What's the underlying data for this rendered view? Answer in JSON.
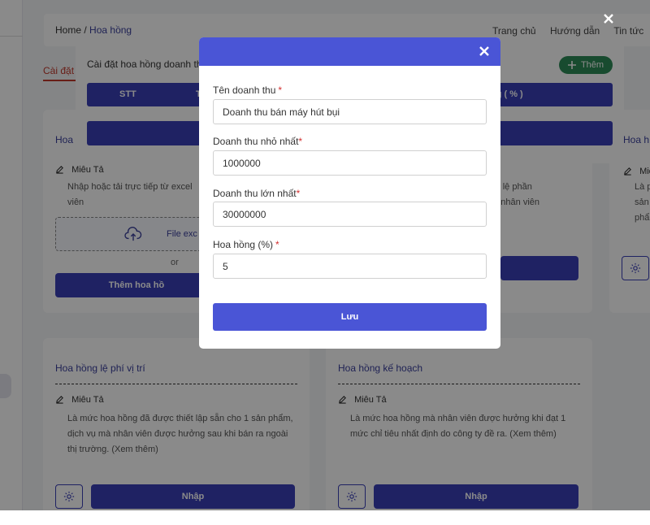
{
  "breadcrumb": {
    "home": "Home",
    "sep": "/",
    "current": "Hoa hồng"
  },
  "top_links": [
    "Trang chủ",
    "Hướng dẫn",
    "Tin tức"
  ],
  "tab_label": "Cài đặt",
  "settings_modal": {
    "title": "Cài đặt hoa hồng doanh th",
    "add_label": "Thêm",
    "columns": [
      "STT",
      "T",
      "ng ( % )"
    ]
  },
  "cards": [
    {
      "title": "Hoa",
      "desc_label": "Miêu Tả",
      "desc": "Nhập hoặc tải trực tiếp từ excel",
      "desc2": "viên",
      "file_label": "File exc",
      "or_label": "or",
      "button_label": "Thêm hoa hồ"
    },
    {
      "desc_frag1": "t tỷ lệ phần",
      "desc_frag2": "do nhân viên"
    },
    {
      "title": "Hoa h",
      "desc_label": "Miê",
      "desc1": "Là p",
      "desc2": "sản",
      "desc3": "phẩ"
    },
    {
      "title": "Hoa hồng lệ phí vị trí",
      "desc_label": "Miêu Tả",
      "desc": "Là mức hoa hồng đã được thiết lập sẵn cho 1 sản phẩm, dịch vụ mà nhân viên được hưởng sau khi bán ra ngoài thị trường. (Xem thêm)",
      "button_label": "Nhập"
    },
    {
      "title": "Hoa hồng kế hoạch",
      "desc_label": "Miêu Tả",
      "desc": "Là mức hoa hồng mà nhân viên được hưởng khi đạt 1 mức chỉ tiêu nhất định do công ty đề ra. (Xem thêm)",
      "button_label": "Nhập"
    }
  ],
  "form": {
    "name_label": "Tên doanh thu",
    "name_value": "Doanh thu bán máy hút bụi",
    "min_label": "Doanh thu nhỏ nhất",
    "min_value": "1000000",
    "max_label": "Doanh thu lớn nhất",
    "max_value": "30000000",
    "rate_label": "Hoa hồng (%)",
    "rate_value": "5",
    "required_mark": "*",
    "save_label": "Lưu"
  },
  "colors": {
    "primary": "#4a55d6",
    "dark_primary": "#3a3fb8",
    "success": "#2e8b57",
    "required": "#d32f2f"
  }
}
